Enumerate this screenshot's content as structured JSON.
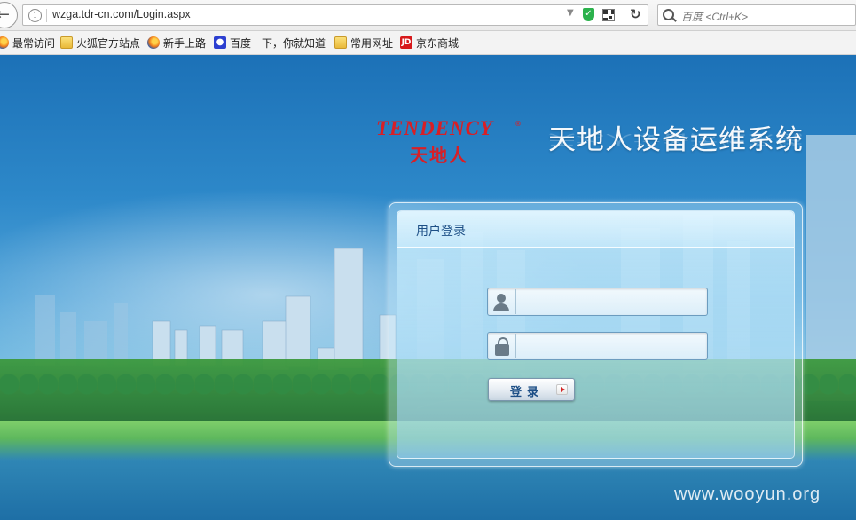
{
  "browser": {
    "url": "wzga.tdr-cn.com/Login.aspx",
    "search_placeholder": "百度 <Ctrl+K>",
    "bookmarks": [
      {
        "label": "最常访问",
        "icon": "firefox-icon"
      },
      {
        "label": "火狐官方站点",
        "icon": "folder-icon"
      },
      {
        "label": "新手上路",
        "icon": "firefox-icon"
      },
      {
        "label": "百度一下，你就知道",
        "icon": "baidu-paw-icon"
      },
      {
        "label": "常用网址",
        "icon": "folder-icon"
      },
      {
        "label": "京东商城",
        "icon": "jd-icon"
      }
    ]
  },
  "brand": {
    "logo_en": "TENDENCY",
    "logo_reg": "®",
    "logo_cn": "天地人",
    "system_title": "天地人设备运维系统"
  },
  "login": {
    "title": "用户登录",
    "username_value": "",
    "password_value": "",
    "button_label": "登录"
  },
  "watermark": "www.wooyun.org",
  "colors": {
    "brand_red": "#d81f26",
    "panel_title": "#1d4f86",
    "sky_blue": "#2d88c9"
  }
}
